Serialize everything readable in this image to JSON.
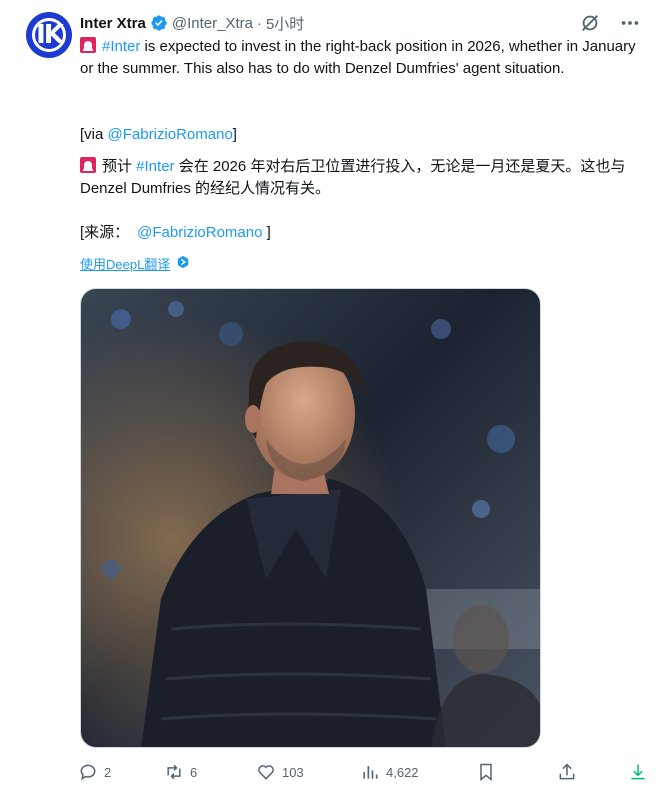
{
  "tweet": {
    "display_name": "Inter Xtra",
    "handle": "@Inter_Xtra",
    "separator": "·",
    "time": "5小时",
    "line1_hashtag": "#Inter",
    "line1_text": " is expected to invest in the right-back position in 2026, whether in January or the summer. This also has to do with Denzel Dumfries' agent situation.",
    "via_prefix": "[via ",
    "via_mention": "@FabrizioRomano",
    "via_suffix": "]",
    "cn_prefix": "预计 ",
    "cn_hashtag": "#Inter",
    "cn_text": " 会在 2026 年对右后卫位置进行投入，无论是一月还是夏天。这也与 Denzel Dumfries 的经纪人情况有关。",
    "src_prefix": "[来源：",
    "src_mention": "@FabrizioRomano",
    "src_suffix": " ]",
    "translate_label": "使用DeepL翻译"
  },
  "actions": {
    "replies": "2",
    "retweets": "6",
    "likes": "103",
    "views": "4,622"
  },
  "colors": {
    "link": "#1d9bf0",
    "muted": "#536471",
    "avatar_bg": "#1d3bd1",
    "download": "#00ba7c"
  },
  "icons": [
    "verified-badge-icon",
    "grok-icon",
    "more-icon",
    "siren-icon",
    "deepl-icon",
    "reply-icon",
    "retweet-icon",
    "like-icon",
    "views-icon",
    "bookmark-icon",
    "share-icon",
    "download-icon"
  ]
}
